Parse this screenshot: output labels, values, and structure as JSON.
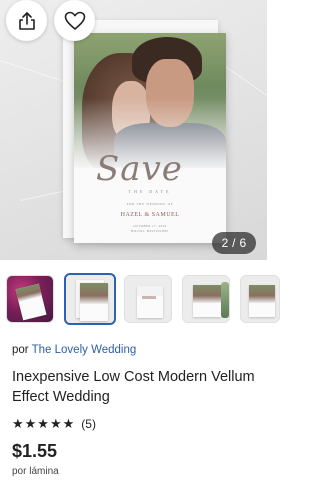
{
  "product_image": {
    "card_script": "Save",
    "card_the_date": "THE DATE",
    "card_line_a": "FOR THE WEDDING OF",
    "card_names": "HAZEL & SAMUEL",
    "card_line_b": "OCTOBER 17, 2026",
    "card_line_c": "BILOXI, MISSISSIPPI",
    "counter": "2 / 6"
  },
  "actions": {
    "share_icon": "share-icon",
    "favorite_icon": "heart-outline-icon"
  },
  "thumbnails": [
    {
      "name": "thumbnail-1",
      "active": false
    },
    {
      "name": "thumbnail-2",
      "active": true
    },
    {
      "name": "thumbnail-3",
      "active": false
    },
    {
      "name": "thumbnail-4",
      "active": false
    },
    {
      "name": "thumbnail-5",
      "active": false
    }
  ],
  "seller": {
    "prefix": "por",
    "shop_name": "The Lovely Wedding"
  },
  "product": {
    "title": "Inexpensive Low Cost Modern Vellum Effect Wedding",
    "rating_stars": "★★★★★",
    "rating_value": 5,
    "review_count": "(5)",
    "price": "$1.55",
    "unit": "por lámina"
  },
  "colors": {
    "link": "#2f5ea3",
    "active_thumb_border": "#2b63b0"
  }
}
